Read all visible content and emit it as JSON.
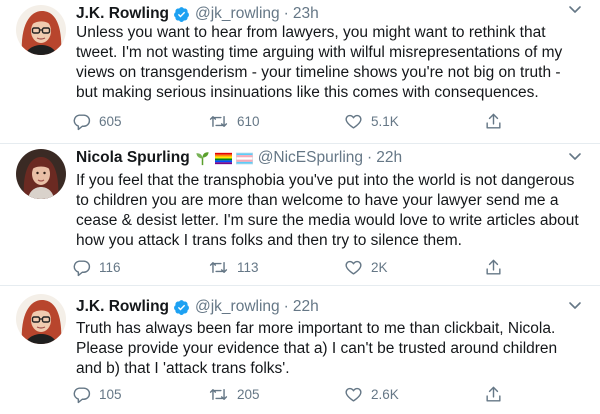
{
  "tweets": [
    {
      "author": "J.K. Rowling",
      "verified": true,
      "handle": "@jk_rowling",
      "separator": "·",
      "time": "23h",
      "text": "Unless you want to hear from lawyers, you might want to rethink that\ntweet. I'm not wasting time arguing with wilful misrepresentations of my\nviews on transgenderism - your timeline shows you're not big on truth -\nbut making serious insinuations like this comes with consequences.",
      "replies": "605",
      "retweets": "610",
      "likes": "5.1K"
    },
    {
      "author": "Nicola Spurling",
      "verified": false,
      "name_emojis": [
        "seedling",
        "rainbow-flag",
        "transgender-flag"
      ],
      "handle": "@NicESpurling",
      "separator": "·",
      "time": "22h",
      "text": "If you feel that the transphobia you've put into the world is not dangerous\nto children you are more than welcome to have your lawyer send me a\ncease & desist letter. I'm sure the media would love to write articles about\nhow you attack I trans folks and then try to silence them.",
      "replies": "116",
      "retweets": "113",
      "likes": "2K"
    },
    {
      "author": "J.K. Rowling",
      "verified": true,
      "handle": "@jk_rowling",
      "separator": "·",
      "time": "22h",
      "text": "Truth has always been far more important to me than clickbait, Nicola.\nPlease provide your evidence that a) I can't be trusted around children\nand b) that I 'attack trans folks'.",
      "replies": "105",
      "retweets": "205",
      "likes": "2.6K"
    }
  ],
  "colors": {
    "text": "#14171a",
    "secondary": "#657786",
    "verified": "#1da1f2",
    "divider": "#e6ecf0"
  }
}
